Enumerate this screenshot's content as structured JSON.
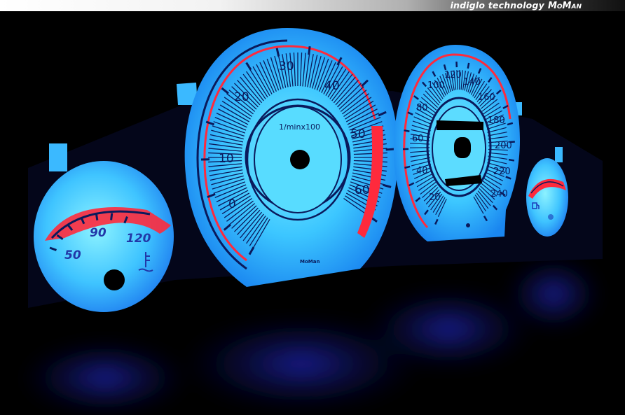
{
  "banner": {
    "tagline": "indiglo technology",
    "brand": "MoMan"
  },
  "colors": {
    "glow": "#2bb5ff",
    "glow_light": "#6fe8ff",
    "ink": "#0a1a5c",
    "redline": "#ff2a3c",
    "background": "#000000",
    "reflection": "#1a24d8"
  },
  "gauges": {
    "temperature": {
      "labels": [
        "50",
        "90",
        "120"
      ],
      "icon": "coolant-temperature-icon"
    },
    "tachometer": {
      "labels": [
        "0",
        "10",
        "20",
        "30",
        "40",
        "50",
        "60"
      ],
      "unit": "1/minx100",
      "maker": "MoMan"
    },
    "speedometer": {
      "labels": [
        "20",
        "40",
        "60",
        "80",
        "100",
        "120",
        "140",
        "160",
        "180",
        "200",
        "220",
        "240"
      ]
    },
    "fuel": {
      "icon": "fuel-pump-icon"
    }
  }
}
